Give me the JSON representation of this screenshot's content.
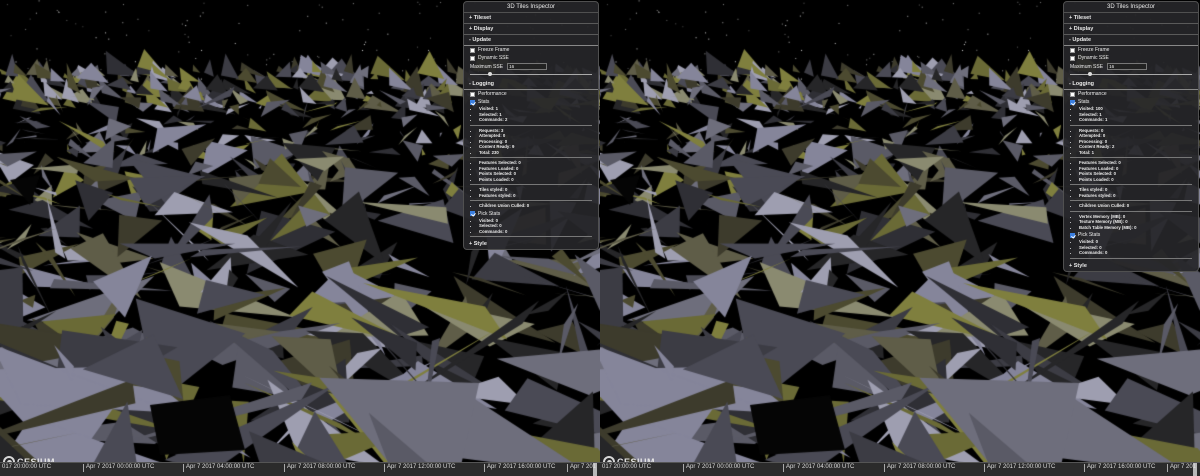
{
  "inspector": {
    "title": "3D Tiles Inspector",
    "sections": {
      "tileset": "+ Tileset",
      "display": "+ Display",
      "update": "- Update",
      "logging": "- Logging",
      "style": "+ Style"
    },
    "update": {
      "freeze_frame": "Freeze Frame",
      "dynamic_sse": "Dynamic SSE",
      "max_sse_label": "Maximum SSE",
      "max_sse_value": "16",
      "slider_level": 0.16
    },
    "logging": {
      "performance": "Performance",
      "stats": "Stats",
      "pick_stats": "Pick Stats"
    }
  },
  "left": {
    "stats_groups": [
      [
        "Visited: 1",
        "Selected: 1",
        "Commands: 2"
      ],
      [
        "Requests: 3",
        "Attempted: 0",
        "Processing: 0",
        "Content Ready: 9",
        "Total: 230"
      ],
      [
        "Features Selected: 0",
        "Features Loaded: 0",
        "Points Selected: 0",
        "Points Loaded: 0"
      ],
      [
        "Tiles styled: 0",
        "Features styled: 0"
      ],
      [
        "Children Union Culled: 0"
      ]
    ],
    "pick_stats": [
      "Visited: 0",
      "Selected: 0",
      "Commands: 0"
    ]
  },
  "right": {
    "stats_groups": [
      [
        "Visited: 100",
        "Selected: 1",
        "Commands: 1"
      ],
      [
        "Requests: 0",
        "Attempted: 0",
        "Processing: 0",
        "Content Ready: 2",
        "Total: 1"
      ],
      [
        "Features Selected: 0",
        "Features Loaded: 0",
        "Points Selected: 0",
        "Points Loaded: 0"
      ],
      [
        "Tiles styled: 0",
        "Features styled: 0"
      ],
      [
        "Children Union Culled: 0"
      ],
      [
        "Vertex Memory (MB): 0",
        "Texture Memory (MB): 0",
        "Batch Table Memory (MB): 0"
      ]
    ],
    "pick_stats": [
      "Visited: 0",
      "Selected: 0",
      "Commands: 0"
    ]
  },
  "logo_text": "CESIUM",
  "timeline": {
    "ticks": [
      "017 20:00:00 UTC",
      "Apr 7 2017 00:00:00 UTC",
      "Apr 7 2017 04:00:00 UTC",
      "Apr 7 2017 08:00:00 UTC",
      "Apr 7 2017 12:00:00 UTC",
      "Apr 7 2017 16:00:00 UTC",
      "Apr 7 201"
    ]
  },
  "colors": {
    "sky": "#000000",
    "terrain_dark": "#3a3a40",
    "terrain_light": "#9a9aa8",
    "terrain_olive": "#7a7a3a",
    "panel_bg": "#262629",
    "checkbox_on": "#3b7fe0"
  }
}
